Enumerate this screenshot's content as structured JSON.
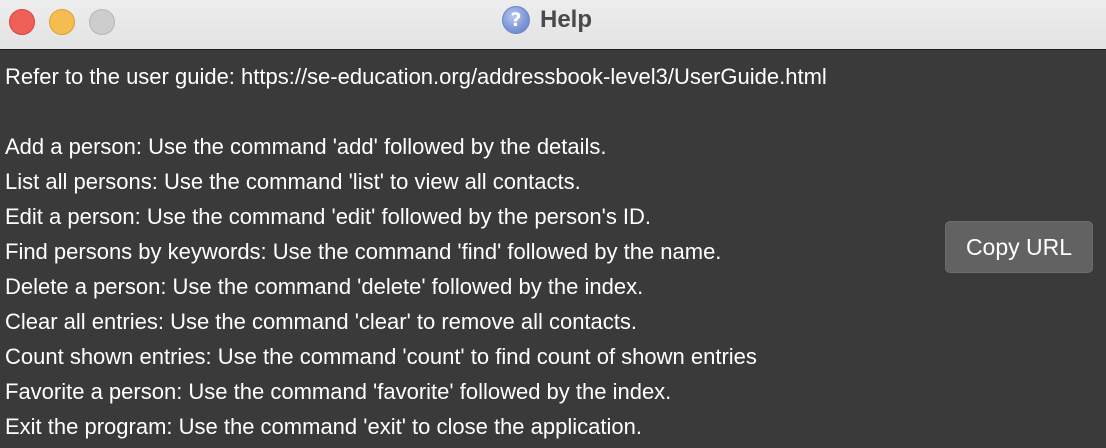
{
  "window": {
    "title": "Help",
    "title_icon": "question-mark-icon"
  },
  "content": {
    "guide_line": "Refer to the user guide: https://se-education.org/addressbook-level3/UserGuide.html",
    "commands": [
      "Add a person: Use the command 'add' followed by the details.",
      "List all persons: Use the command 'list' to view all contacts.",
      "Edit a person: Use the command 'edit' followed by the person's ID.",
      "Find persons by keywords: Use the command 'find' followed by the name.",
      "Delete a person: Use the command 'delete' followed by the index.",
      "Clear all entries: Use the command 'clear' to remove all contacts.",
      "Count shown entries: Use the command 'count' to find count of shown entries",
      "Favorite a person: Use the command 'favorite' followed by the index.",
      "Exit the program: Use the command 'exit' to close the application."
    ]
  },
  "buttons": {
    "copy_url": "Copy URL"
  },
  "colors": {
    "background": "#3a3a3a",
    "text": "#ffffff",
    "button": "#626262",
    "close": "#ee5f57",
    "minimize": "#f5bd4f",
    "zoom": "#cdcdcd"
  }
}
